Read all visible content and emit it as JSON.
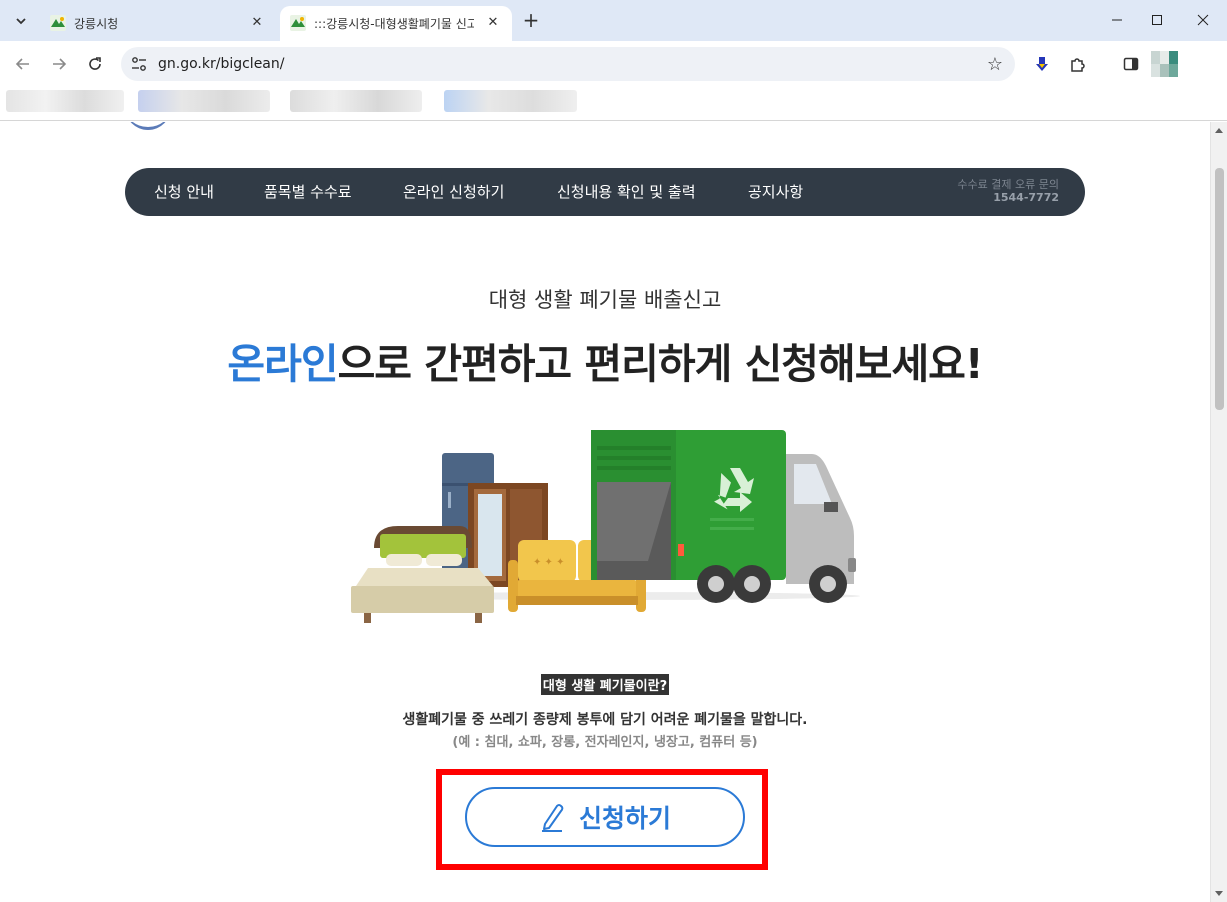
{
  "browser": {
    "tabs": [
      {
        "title": "강릉시청",
        "active": false
      },
      {
        "title": ":::강릉시청-대형생활폐기물 신고",
        "active": true
      }
    ],
    "url": "gn.go.kr/bigclean/"
  },
  "page": {
    "nav": {
      "items": [
        "신청 안내",
        "품목별 수수료",
        "온라인 신청하기",
        "신청내용 확인 및 출력",
        "공지사항"
      ],
      "contact_label": "수수료 결제 오류 문의",
      "contact_number": "1544-7772"
    },
    "hero": {
      "subtitle": "대형 생활 폐기물 배출신고",
      "title_highlight": "온라인",
      "title_rest": "으로 간편하고 편리하게 신청해보세요!"
    },
    "definition": {
      "title": "대형 생활 폐기물이란?",
      "description": "생활폐기물 중 쓰레기 종량제 봉투에 담기 어려운 폐기물을 말합니다.",
      "examples": "(예 : 침대, 쇼파, 장롱, 전자레인지, 냉장고, 컴퓨터 등)"
    },
    "apply_button": "신청하기"
  },
  "colors": {
    "accent": "#2b7ad6",
    "nav_bg": "#313b46",
    "highlight_box": "#ff0000",
    "truck_green": "#2f9e35"
  }
}
